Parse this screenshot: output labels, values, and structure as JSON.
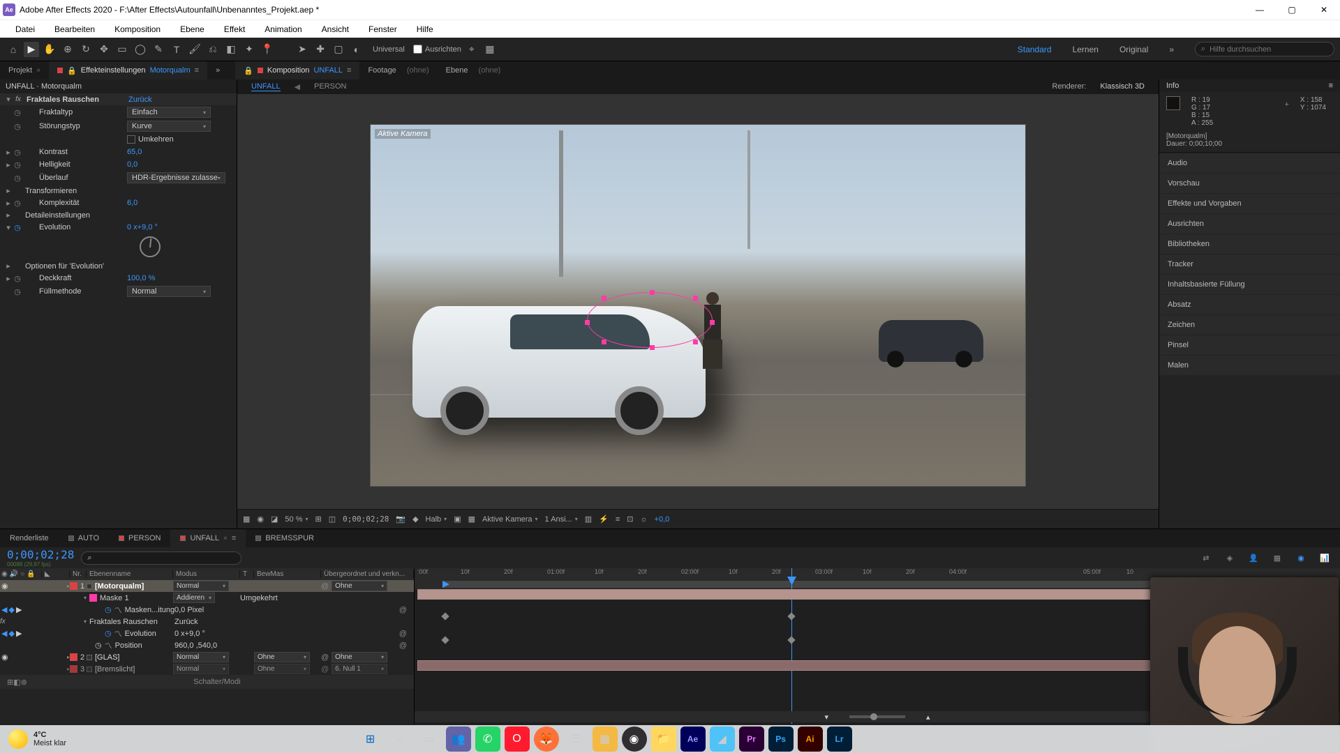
{
  "window": {
    "title": "Adobe After Effects 2020 - F:\\After Effects\\Autounfall\\Unbenanntes_Projekt.aep *",
    "app": "Ae"
  },
  "menu": [
    "Datei",
    "Bearbeiten",
    "Komposition",
    "Ebene",
    "Effekt",
    "Animation",
    "Ansicht",
    "Fenster",
    "Hilfe"
  ],
  "toolbar": {
    "universal_label": "Universal",
    "align_label": "Ausrichten",
    "workspaces": [
      "Standard",
      "Lernen",
      "Original"
    ],
    "search_placeholder": "Hilfe durchsuchen"
  },
  "left_tabs": {
    "projekt": "Projekt",
    "effect_settings": "Effekteinstellungen",
    "subject": "Motorqualm"
  },
  "effect_header": "UNFALL · Motorqualm",
  "effect": {
    "name": "Fraktales Rauschen",
    "preset": "Zurück",
    "rows": {
      "fraktaltyp": {
        "label": "Fraktaltyp",
        "value": "Einfach"
      },
      "storungstyp": {
        "label": "Störungstyp",
        "value": "Kurve"
      },
      "umkehren": {
        "label": "Umkehren"
      },
      "kontrast": {
        "label": "Kontrast",
        "value": "65,0"
      },
      "helligkeit": {
        "label": "Helligkeit",
        "value": "0,0"
      },
      "uberlauf": {
        "label": "Überlauf",
        "value": "HDR-Ergebnisse zulasse"
      },
      "transformieren": "Transformieren",
      "komplexitat": {
        "label": "Komplexität",
        "value": "6,0"
      },
      "detail": "Detaileinstellungen",
      "evolution": {
        "label": "Evolution",
        "value": "0 x+9,0 °"
      },
      "evo_options": "Optionen für 'Evolution'",
      "deckkraft": {
        "label": "Deckkraft",
        "value": "100,0 %"
      },
      "fullmethode": {
        "label": "Füllmethode",
        "value": "Normal"
      }
    }
  },
  "comp_panel": {
    "tab_label": "Komposition",
    "comp_name": "UNFALL",
    "footage": "Footage",
    "none": "(ohne)",
    "ebene": "Ebene",
    "breadcrumb": [
      "UNFALL",
      "PERSON"
    ],
    "renderer_label": "Renderer:",
    "renderer_value": "Klassisch 3D",
    "aktive_kamera": "Aktive Kamera"
  },
  "viewer_footer": {
    "zoom": "50 %",
    "timecode": "0;00;02;28",
    "resolution": "Halb",
    "camera": "Aktive Kamera",
    "views": "1 Ansi...",
    "exposure": "+0,0"
  },
  "info": {
    "title": "Info",
    "r": "R :",
    "r_v": "19",
    "g": "G :",
    "g_v": "17",
    "b": "B :",
    "b_v": "15",
    "a": "A :",
    "a_v": "255",
    "x": "X :",
    "x_v": "158",
    "y": "Y :",
    "y_v": "1074",
    "layer": "[Motorqualm]",
    "duration": "Dauer: 0;00;10;00"
  },
  "right_panels": [
    "Audio",
    "Vorschau",
    "Effekte und Vorgaben",
    "Ausrichten",
    "Bibliotheken",
    "Tracker",
    "Inhaltsbasierte Füllung",
    "Absatz",
    "Zeichen",
    "Pinsel",
    "Malen"
  ],
  "timeline": {
    "tabs": [
      "Renderliste",
      "AUTO",
      "PERSON",
      "UNFALL",
      "BREMSSPUR"
    ],
    "active_tab": 3,
    "timecode": "0;00;02;28",
    "frame_info": "00088 (29,97 fps)",
    "columns": {
      "nr": "Nr.",
      "name": "Ebenenname",
      "modus": "Modus",
      "t": "T",
      "bewmas": "BewMas",
      "parent": "Übergeordnet und verkn..."
    },
    "ruler": [
      ":00f",
      "10f",
      "20f",
      "01:00f",
      "10f",
      "20f",
      "02:00f",
      "10f",
      "20f",
      "03:00f",
      "10f",
      "20f",
      "04:00f",
      "05:00f",
      "10"
    ],
    "layers": [
      {
        "nr": "1",
        "color": "#d84444",
        "name": "[Motorqualm]",
        "mode": "Normal",
        "parent": "Ohne",
        "selected": true
      },
      {
        "nr": "2",
        "color": "#d84444",
        "name": "[GLAS]",
        "mode": "Normal",
        "bewmas": "Ohne",
        "parent": "Ohne"
      },
      {
        "nr": "3",
        "color": "#d84444",
        "name": "[Bremslicht]",
        "mode": "Normal",
        "bewmas": "Ohne",
        "parent": "6. Null 1"
      }
    ],
    "mask": {
      "name": "Maske 1",
      "mode": "Addieren",
      "option": "Umgekehrt"
    },
    "props": {
      "masken": {
        "label": "Masken...itung",
        "value": "0,0 Pixel"
      },
      "fraktales": {
        "label": "Fraktales Rauschen",
        "value": "Zurück"
      },
      "evolution": {
        "label": "Evolution",
        "value": "0 x+9,0 °"
      },
      "position": {
        "label": "Position",
        "value": "960,0 ,540,0"
      }
    },
    "footer": "Schalter/Modi"
  },
  "weather": {
    "temp": "4°C",
    "cond": "Meist klar"
  }
}
